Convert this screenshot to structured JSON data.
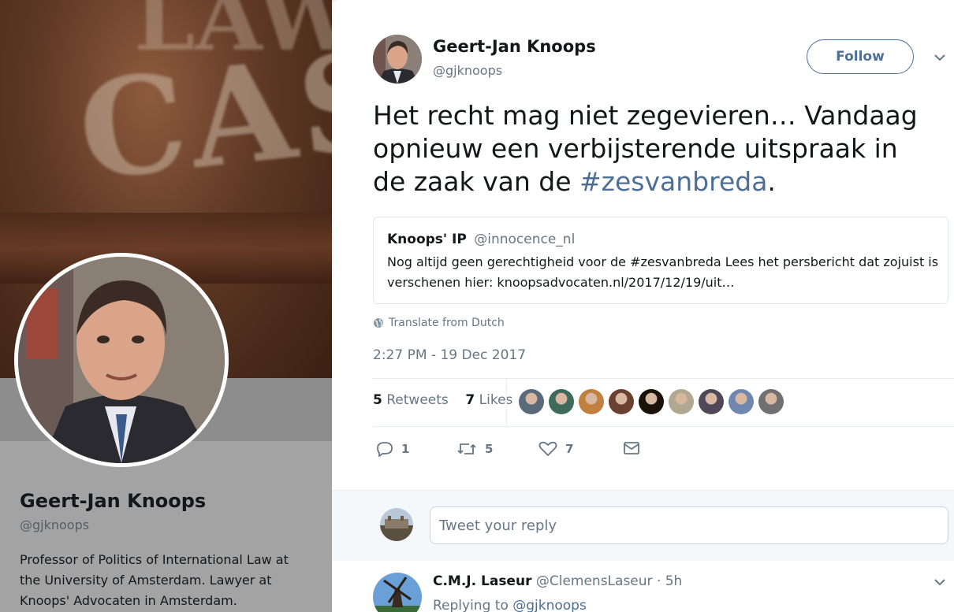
{
  "background_profile": {
    "name": "Geert-Jan Knoops",
    "handle": "@gjknoops",
    "bio": "Professor of Politics of International Law at the University of Amsterdam. Lawyer at Knoops' Advocaten in Amsterdam."
  },
  "tweet": {
    "author_name": "Geert-Jan Knoops",
    "author_handle": "@gjknoops",
    "follow_label": "Follow",
    "text_before": "Het recht mag niet zegevieren… Vandaag opnieuw een verbijsterende uitspraak in de zaak van de ",
    "hashtag": "#zesvanbreda",
    "text_after": ".",
    "quote": {
      "name": "Knoops' IP",
      "handle": "@innocence_nl",
      "body": "Nog altijd geen gerechtigheid voor de #zesvanbreda Lees het persbericht dat zojuist is verschenen hier: knoopsadvocaten.nl/2017/12/19/uit…"
    },
    "translate_label": "Translate from Dutch",
    "timestamp": "2:27 PM - 19 Dec 2017",
    "retweets_count": "5",
    "retweets_label": "Retweets",
    "likes_count": "7",
    "likes_label": "Likes",
    "likers": [
      {
        "icon": "liker-avatar",
        "color": "#5a6a7a"
      },
      {
        "icon": "liker-avatar",
        "color": "#3d6a5a"
      },
      {
        "icon": "liker-avatar",
        "color": "#c08040"
      },
      {
        "icon": "liker-avatar",
        "color": "#6a4030"
      },
      {
        "icon": "liker-avatar",
        "color": "#1a1208"
      },
      {
        "icon": "liker-avatar",
        "color": "#b0a890"
      },
      {
        "icon": "liker-avatar",
        "color": "#504858"
      },
      {
        "icon": "liker-avatar",
        "color": "#7088b0"
      },
      {
        "icon": "liker-avatar",
        "color": "#707070"
      }
    ],
    "actions": {
      "reply_count": "1",
      "retweet_count": "5",
      "like_count": "7"
    }
  },
  "reply_box": {
    "placeholder": "Tweet your reply"
  },
  "reply": {
    "name": "C.M.J. Laseur",
    "handle": "@ClemensLaseur",
    "time": "· 5h",
    "replying_prefix": "Replying to ",
    "replying_to": "@gjknoops"
  },
  "colors": {
    "link": "#4d6f95",
    "muted": "#657786",
    "text": "#14171a"
  }
}
